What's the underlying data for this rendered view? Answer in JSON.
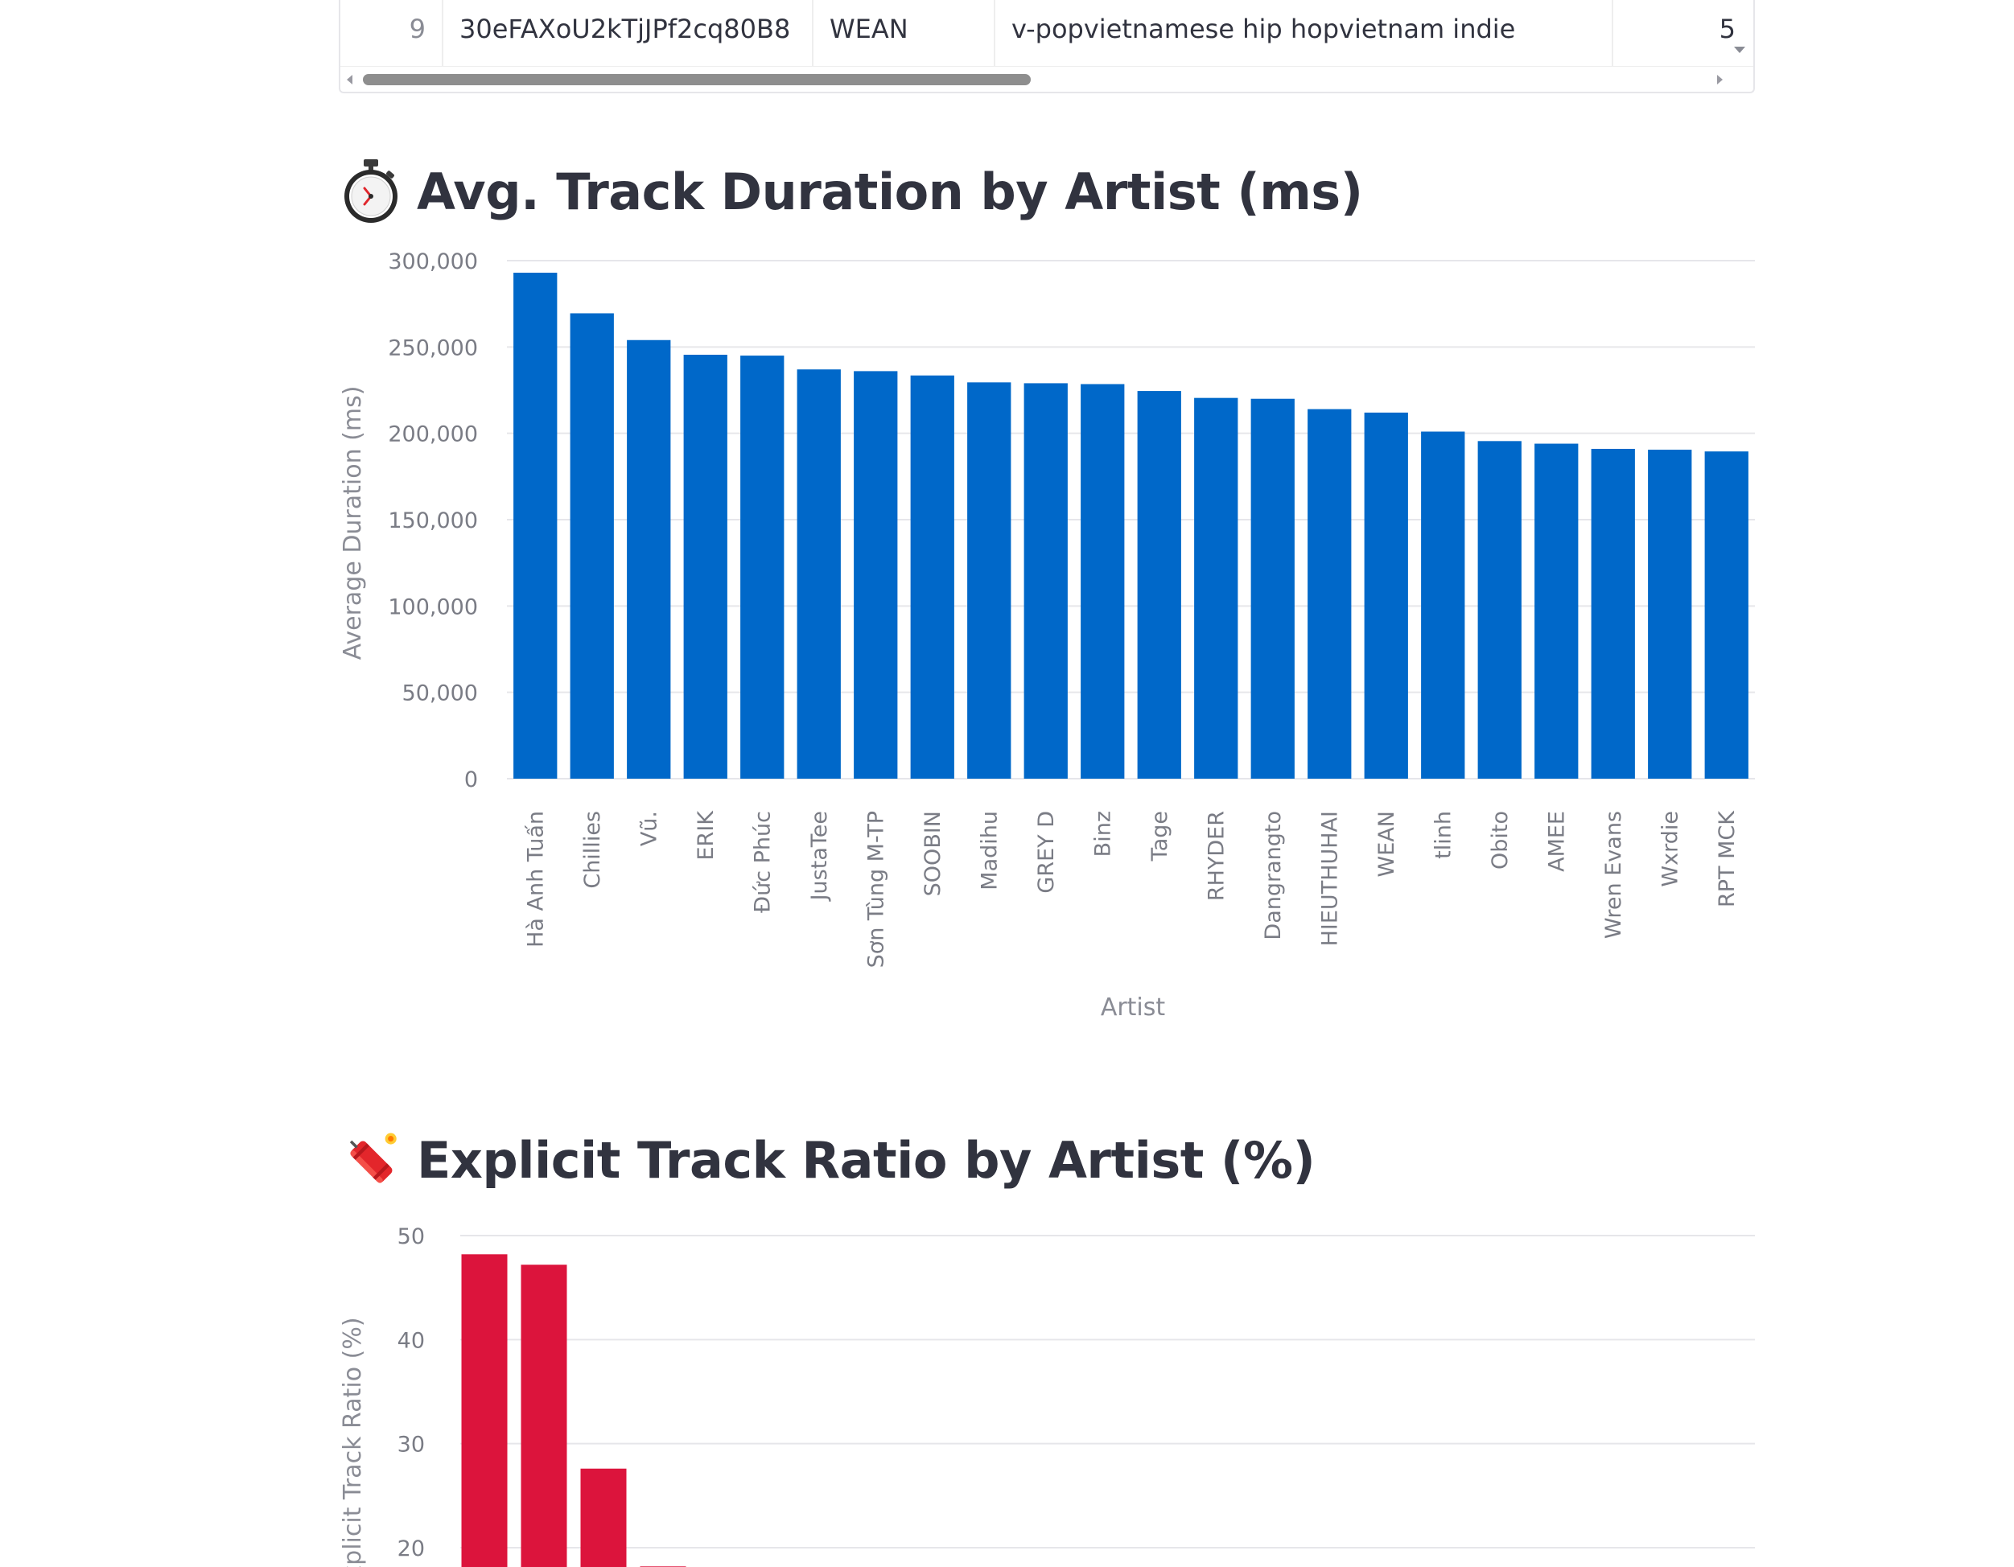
{
  "table": {
    "row": {
      "index": "9",
      "track_id": "30eFAXoU2kTjJPf2cq80B8",
      "artist": "WEAN",
      "genres": "v-popvietnamese hip hopvietnam indie",
      "count": "5"
    }
  },
  "sections": {
    "duration_heading": "Avg. Track Duration by Artist (ms)",
    "duration_icon": "stopwatch-icon",
    "explicit_heading": "Explicit Track Ratio by Artist (%)",
    "explicit_icon": "firecracker-icon"
  },
  "chart_data": [
    {
      "type": "bar",
      "title": "Avg. Track Duration by Artist (ms)",
      "xlabel": "Artist",
      "ylabel": "Average Duration (ms)",
      "ylim": [
        0,
        300000
      ],
      "yticks": [
        0,
        50000,
        100000,
        150000,
        200000,
        250000,
        300000
      ],
      "ytick_labels": [
        "0",
        "50,000",
        "100,000",
        "150,000",
        "200,000",
        "250,000",
        "300,000"
      ],
      "grid": true,
      "color": "#0068c9",
      "categories": [
        "Hà Anh Tuấn",
        "Chillies",
        "Vũ.",
        "ERIK",
        "Đức Phúc",
        "JustaTee",
        "Sơn Tùng M-TP",
        "SOOBIN",
        "Madihu",
        "GREY D",
        "Binz",
        "Tage",
        "RHYDER",
        "Dangrangto",
        "HIEUTHUHAI",
        "WEAN",
        "tlinh",
        "Obito",
        "AMEE",
        "Wren Evans",
        "Wxrdie",
        "RPT MCK"
      ],
      "values": [
        293000,
        269500,
        254000,
        245500,
        245000,
        237000,
        236000,
        233500,
        229500,
        229000,
        228500,
        224500,
        220500,
        220000,
        214000,
        212000,
        201000,
        195500,
        194000,
        191000,
        190500,
        189500
      ]
    },
    {
      "type": "bar",
      "title": "Explicit Track Ratio by Artist (%)",
      "xlabel": "",
      "ylabel": "Explicit Track Ratio (%)",
      "yticks": [
        20,
        30,
        40,
        50
      ],
      "ytick_labels": [
        "20",
        "30",
        "40",
        "50"
      ],
      "grid": true,
      "color": "#dc143c",
      "values": [
        48.2,
        47.2,
        27.6,
        18.2
      ]
    }
  ]
}
